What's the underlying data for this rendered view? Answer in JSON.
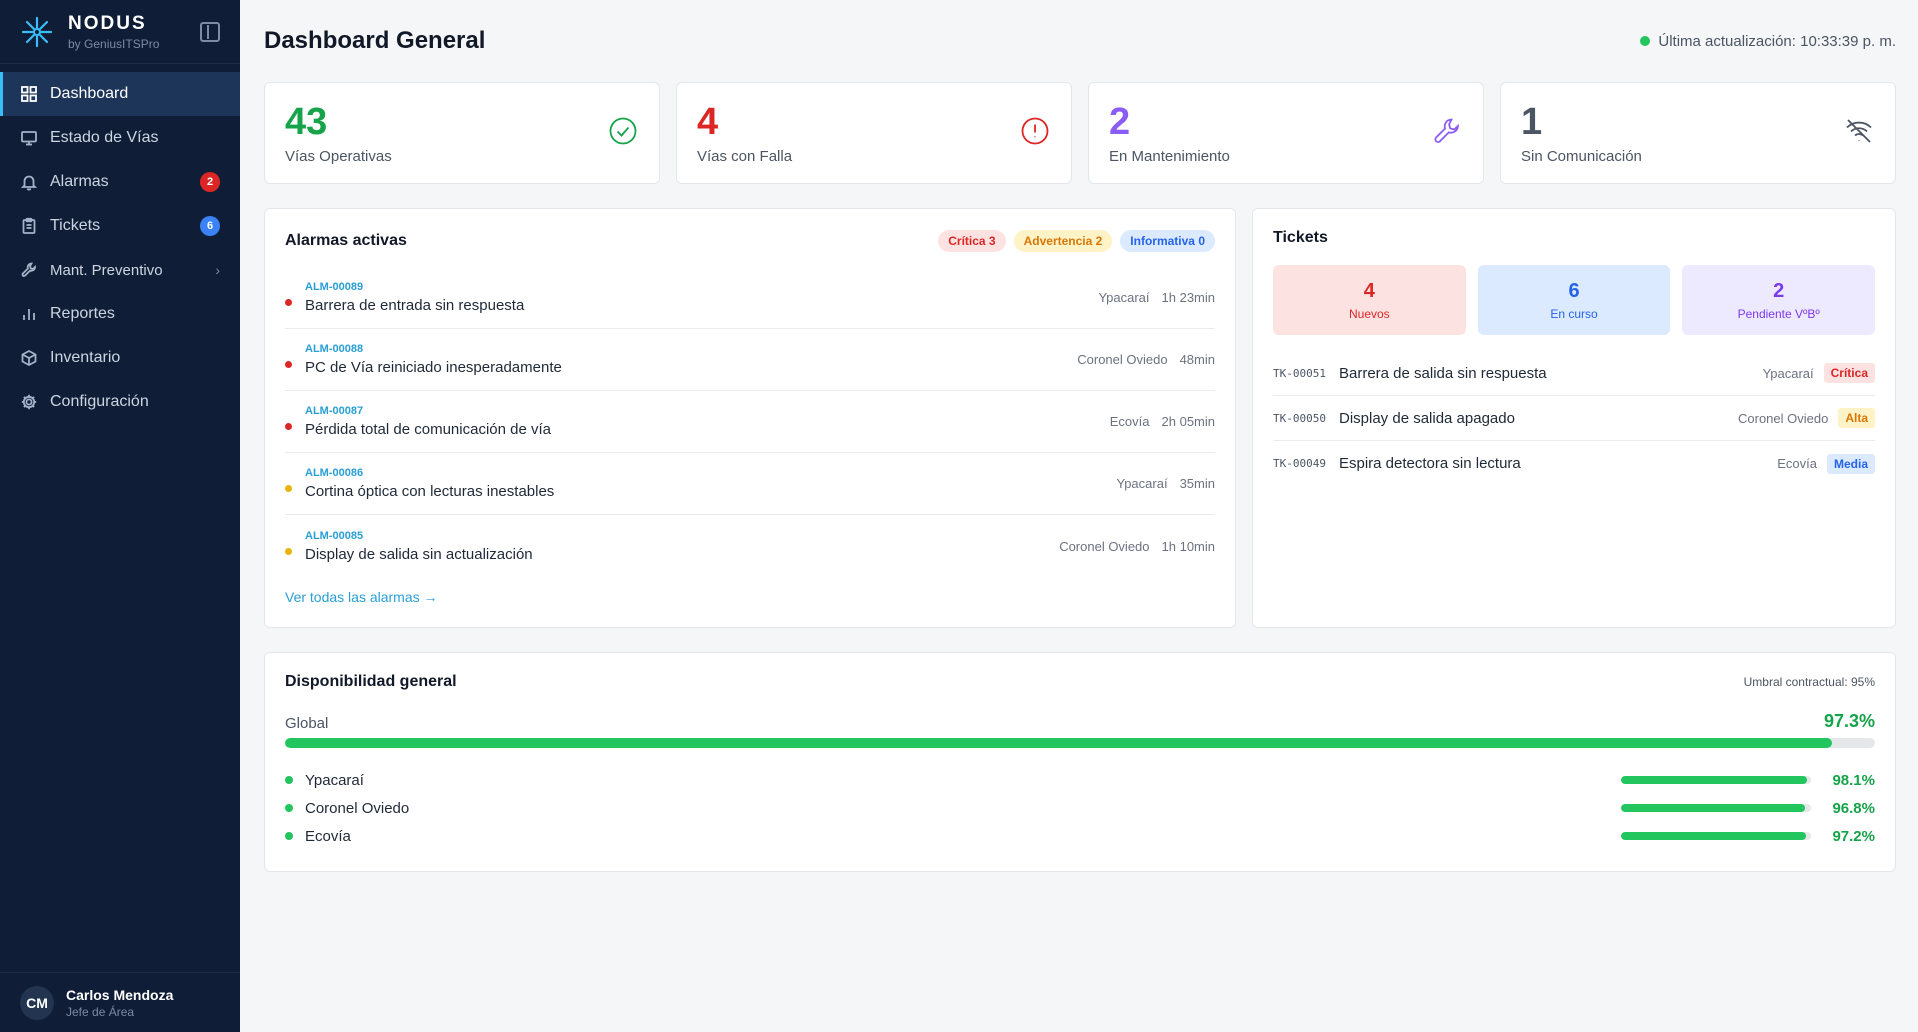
{
  "brand": {
    "name": "NODUS",
    "sub": "by GeniusITSPro",
    "logo_icon": "asterisk-icon"
  },
  "sidebar": {
    "items": [
      {
        "label": "Dashboard",
        "icon": "grid-icon",
        "active": true
      },
      {
        "label": "Estado de Vías",
        "icon": "monitor-icon"
      },
      {
        "label": "Alarmas",
        "icon": "bell-icon",
        "badge": "2",
        "badge_color": "#dc2626"
      },
      {
        "label": "Tickets",
        "icon": "clipboard-icon",
        "badge": "6",
        "badge_color": "#3b82f6"
      },
      {
        "label": "Mant. Preventivo",
        "icon": "wrench-icon",
        "chevron": "›"
      },
      {
        "label": "Reportes",
        "icon": "bar-chart-icon"
      },
      {
        "label": "Inventario",
        "icon": "box-icon"
      },
      {
        "label": "Configuración",
        "icon": "gear-icon"
      }
    ]
  },
  "user": {
    "initials": "CM",
    "name": "Carlos Mendoza",
    "role": "Jefe de Área"
  },
  "header": {
    "title": "Dashboard General",
    "update": "Última actualización: 10:33:39 p. m.",
    "status_color": "#22c55e"
  },
  "stats": [
    {
      "value": "43",
      "label": "Vías Operativas",
      "color": "#16a34a",
      "icon": "check-circle-icon"
    },
    {
      "value": "4",
      "label": "Vías con Falla",
      "color": "#dc2626",
      "icon": "alert-circle-icon"
    },
    {
      "value": "2",
      "label": "En Mantenimiento",
      "color": "#8b5cf6",
      "icon": "wrench-icon"
    },
    {
      "value": "1",
      "label": "Sin Comunicación",
      "color": "#4b5563",
      "icon": "wifi-off-icon"
    }
  ],
  "alarms": {
    "title": "Alarmas activas",
    "chips": [
      {
        "label": "Crítica 3",
        "bg": "#fde2e2",
        "fg": "#dc2626"
      },
      {
        "label": "Advertencia 2",
        "bg": "#fef3c7",
        "fg": "#d97706"
      },
      {
        "label": "Informativa 0",
        "bg": "#dbeafe",
        "fg": "#2563eb"
      }
    ],
    "items": [
      {
        "id": "ALM-00089",
        "desc": "Barrera de entrada sin respuesta",
        "location": "Ypacaraí",
        "time": "1h 23min",
        "severity_color": "#dc2626"
      },
      {
        "id": "ALM-00088",
        "desc": "PC de Vía reiniciado inesperadamente",
        "location": "Coronel Oviedo",
        "time": "48min",
        "severity_color": "#dc2626"
      },
      {
        "id": "ALM-00087",
        "desc": "Pérdida total de comunicación de vía",
        "location": "Ecovía",
        "time": "2h 05min",
        "severity_color": "#dc2626"
      },
      {
        "id": "ALM-00086",
        "desc": "Cortina óptica con lecturas inestables",
        "location": "Ypacaraí",
        "time": "35min",
        "severity_color": "#eab308"
      },
      {
        "id": "ALM-00085",
        "desc": "Display de salida sin actualización",
        "location": "Coronel Oviedo",
        "time": "1h 10min",
        "severity_color": "#eab308"
      }
    ],
    "see_all": "Ver todas las alarmas →"
  },
  "tickets": {
    "title": "Tickets",
    "summary": [
      {
        "value": "4",
        "label": "Nuevos",
        "bg": "#fde2e2",
        "fg": "#dc2626"
      },
      {
        "value": "6",
        "label": "En curso",
        "bg": "#dbeafe",
        "fg": "#2563eb"
      },
      {
        "value": "2",
        "label": "Pendiente VºBº",
        "bg": "#ede9fe",
        "fg": "#7c3aed"
      }
    ],
    "items": [
      {
        "id": "TK-00051",
        "desc": "Barrera de salida sin respuesta",
        "location": "Ypacaraí",
        "priority": "Crítica",
        "p_bg": "#fde2e2",
        "p_fg": "#dc2626"
      },
      {
        "id": "TK-00050",
        "desc": "Display de salida apagado",
        "location": "Coronel Oviedo",
        "priority": "Alta",
        "p_bg": "#fef3c7",
        "p_fg": "#d97706"
      },
      {
        "id": "TK-00049",
        "desc": "Espira detectora sin lectura",
        "location": "Ecovía",
        "priority": "Media",
        "p_bg": "#dbeafe",
        "p_fg": "#2563eb"
      }
    ]
  },
  "availability": {
    "title": "Disponibilidad general",
    "threshold": "Umbral contractual: 95%",
    "global_label": "Global",
    "global_value": "97.3%",
    "global_fraction": 0.973,
    "sites": [
      {
        "name": "Ypacaraí",
        "value": "98.1%",
        "fraction": 0.981
      },
      {
        "name": "Coronel Oviedo",
        "value": "96.8%",
        "fraction": 0.968
      },
      {
        "name": "Ecovía",
        "value": "97.2%",
        "fraction": 0.972
      }
    ]
  }
}
